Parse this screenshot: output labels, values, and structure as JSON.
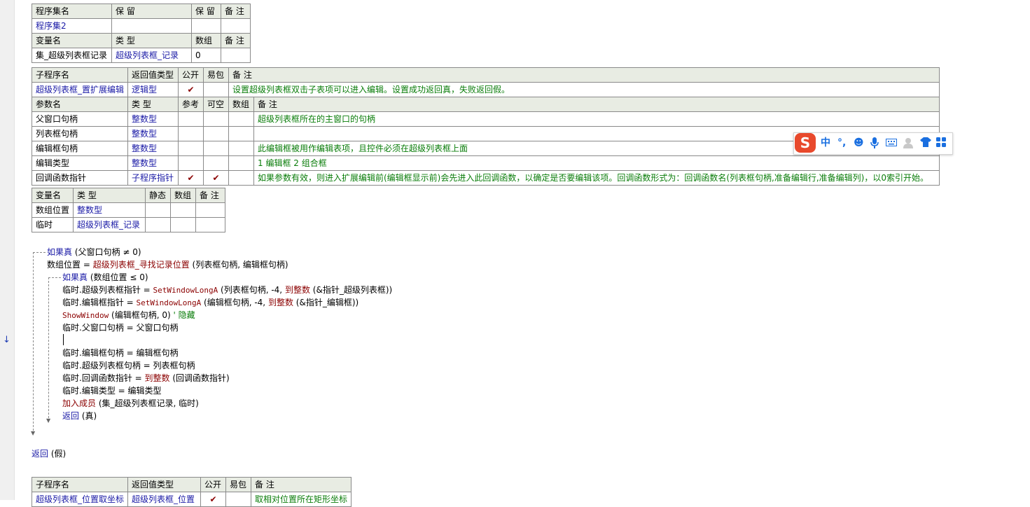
{
  "assembly_table": {
    "header": [
      "程序集名",
      "保 留",
      "保 留",
      "备 注"
    ],
    "row": [
      "程序集2",
      "",
      "",
      ""
    ],
    "var_header": [
      "变量名",
      "类 型",
      "数组",
      "备 注"
    ],
    "var_row": [
      "集_超级列表框记录",
      "超级列表框_记录",
      "0",
      ""
    ]
  },
  "sub_table": {
    "header": [
      "子程序名",
      "返回值类型",
      "公开",
      "易包",
      "备 注"
    ],
    "row": {
      "name": "超级列表框_置扩展编辑",
      "type": "逻辑型",
      "public": "✔",
      "easy": "",
      "note": "设置超级列表框双击子表项可以进入编辑。设置成功返回真，失败返回假。"
    },
    "param_header": [
      "参数名",
      "类 型",
      "参考",
      "可空",
      "数组",
      "备 注"
    ],
    "params": [
      {
        "name": "父窗口句柄",
        "type": "整数型",
        "ref": "",
        "opt": "",
        "arr": "",
        "note": "超级列表框所在的主窗口的句柄"
      },
      {
        "name": "列表框句柄",
        "type": "整数型",
        "ref": "",
        "opt": "",
        "arr": "",
        "note": ""
      },
      {
        "name": "编辑框句柄",
        "type": "整数型",
        "ref": "",
        "opt": "",
        "arr": "",
        "note": "此编辑框被用作编辑表项，且控件必须在超级列表框上面"
      },
      {
        "name": "编辑类型",
        "type": "整数型",
        "ref": "",
        "opt": "",
        "arr": "",
        "note": "1 编辑框  2 组合框"
      },
      {
        "name": "回调函数指针",
        "type": "子程序指针",
        "ref": "✔",
        "opt": "✔",
        "arr": "",
        "note": "如果参数有效，则进入扩展编辑前(编辑框显示前)会先进入此回调函数，以确定是否要编辑该项。回调函数形式为：回调函数名(列表框句柄,准备编辑行,准备编辑列)，以0索引开始。"
      }
    ]
  },
  "local_table": {
    "header": [
      "变量名",
      "类 型",
      "静态",
      "数组",
      "备 注"
    ],
    "rows": [
      {
        "name": "数组位置",
        "type": "整数型"
      },
      {
        "name": "临时",
        "type": "超级列表框_记录"
      }
    ]
  },
  "code": {
    "l1_kw": "如果真",
    "l1_rest": " (父窗口句柄 ≠ 0)",
    "l2_a": "数组位置 = ",
    "l2_fn": "超级列表框_寻找记录位置",
    "l2_rest": " (列表框句柄, 编辑框句柄)",
    "l3_kw": "如果真",
    "l3_rest": " (数组位置 ≤ 0)",
    "l4_a": "临时.超级列表框指针 = ",
    "l4_api": "SetWindowLongA",
    "l4_b": " (列表框句柄, -4, ",
    "l4_fn": "到整数",
    "l4_c": " (&指针_超级列表框))",
    "l5_a": "临时.编辑框指针 = ",
    "l5_api": "SetWindowLongA",
    "l5_b": " (编辑框句柄, -4, ",
    "l5_fn": "到整数",
    "l5_c": " (&指针_编辑框))",
    "l6_api": "ShowWindow",
    "l6_b": " (编辑框句柄, 0)  ",
    "l6_cmt": "' 隐藏",
    "l7": "临时.父窗口句柄 = 父窗口句柄",
    "l9": "临时.编辑框句柄 = 编辑框句柄",
    "l10": "临时.超级列表框句柄 = 列表框句柄",
    "l11_a": "临时.回调函数指针 = ",
    "l11_fn": "到整数",
    "l11_b": " (回调函数指针)",
    "l12": "临时.编辑类型 = 编辑类型",
    "l13_fn": "加入成员",
    "l13_b": " (集_超级列表框记录, 临时)",
    "l14_kw": "返回",
    "l14_b": " (真)",
    "l15_kw": "返回",
    "l15_b": " (假)"
  },
  "sub_table2": {
    "header": [
      "子程序名",
      "返回值类型",
      "公开",
      "易包",
      "备 注"
    ],
    "row": {
      "name": "超级列表框_位置取坐标",
      "type": "超级列表框_位置",
      "public": "✔",
      "note": "取相对位置所在矩形坐标"
    }
  },
  "ime_toolbar": {
    "logo": "S",
    "lang": "中",
    "punct": "°,",
    "icons": [
      "emoji-icon",
      "mic-icon",
      "keyboard-icon",
      "user-icon",
      "skin-icon",
      "grid-icon"
    ]
  }
}
